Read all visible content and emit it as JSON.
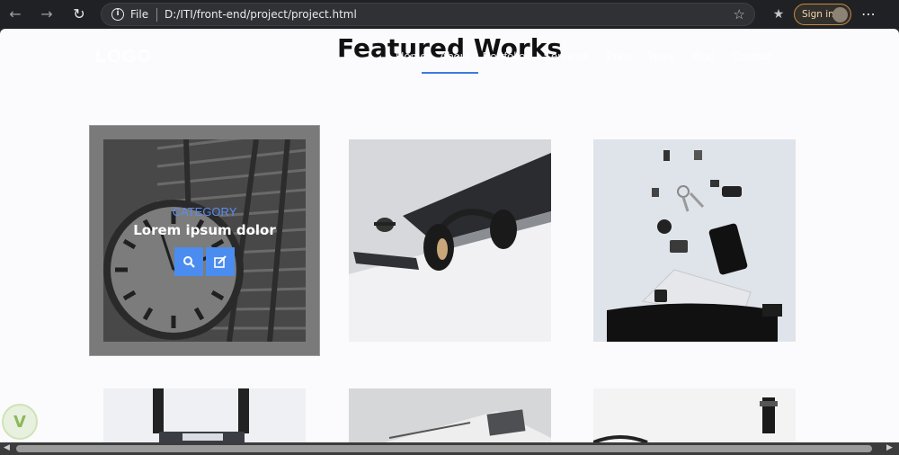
{
  "browser": {
    "file_label": "File",
    "url": "D:/ITI/front-end/project/project.html",
    "signin_label": "Sign in"
  },
  "site": {
    "logo": "LOGO",
    "menu": [
      "Home",
      "About",
      "Portfolio",
      "Services",
      "Price",
      "Team",
      "Blog",
      "Contact"
    ]
  },
  "section": {
    "title": "Featured Works",
    "overlay": {
      "category": "CATEGORY",
      "caption": "Lorem ipsum dolor"
    }
  },
  "colors": {
    "accent": "#4b8cf0",
    "title_underline": "#3d7be0"
  }
}
